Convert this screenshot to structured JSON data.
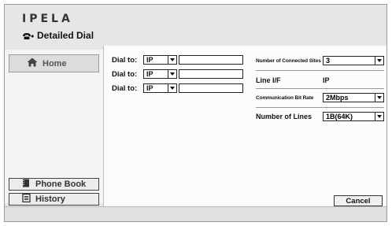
{
  "app": {
    "logo": "IPELA",
    "screen_title": "Detailed Dial"
  },
  "sidebar": {
    "home": "Home",
    "phone_book": "Phone Book",
    "history": "History"
  },
  "dial": [
    {
      "label": "Dial to:",
      "type": "IP",
      "address": ""
    },
    {
      "label": "Dial to:",
      "type": "IP",
      "address": ""
    },
    {
      "label": "Dial to:",
      "type": "IP",
      "address": ""
    }
  ],
  "settings": {
    "connected_sites_label": "Number of Connected Sites",
    "connected_sites_value": "3",
    "line_if_label": "Line I/F",
    "line_if_value": "IP",
    "bit_rate_label": "Communication Bit Rate",
    "bit_rate_value": "2Mbps",
    "lines_label": "Number of Lines",
    "lines_value": "1B(64K)"
  },
  "actions": {
    "cancel": "Cancel"
  },
  "colors": {
    "frame": "#e6e6e6",
    "content": "#fcfcfc",
    "border": "#222222"
  }
}
